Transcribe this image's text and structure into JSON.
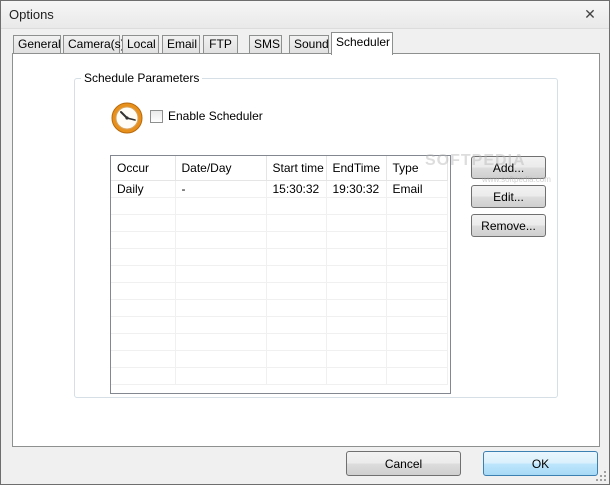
{
  "window": {
    "title": "Options",
    "close_glyph": "✕"
  },
  "tabs": [
    {
      "label": "General"
    },
    {
      "label": "Camera(s)"
    },
    {
      "label": "Local"
    },
    {
      "label": "Email"
    },
    {
      "label": "FTP"
    },
    {
      "label": "SMS"
    },
    {
      "label": "Sound"
    },
    {
      "label": "Scheduler",
      "active": true
    }
  ],
  "scheduler": {
    "group_title": "Schedule Parameters",
    "icon": "clock-icon",
    "enable_label": "Enable Scheduler",
    "enable_checked": false,
    "columns": [
      "Occur",
      "Date/Day",
      "Start time",
      "EndTime",
      "Type"
    ],
    "rows": [
      [
        "Daily",
        "-",
        "15:30:32",
        "19:30:32",
        "Email"
      ]
    ],
    "buttons": {
      "add": "Add...",
      "edit": "Edit...",
      "remove": "Remove..."
    }
  },
  "footer": {
    "cancel": "Cancel",
    "ok": "OK"
  },
  "watermark": {
    "text": "SOFTPEDIA",
    "url": "www.softpedia.com"
  },
  "colors": {
    "accent_button": "#a7d9f5",
    "clock_orange": "#e8901c"
  }
}
